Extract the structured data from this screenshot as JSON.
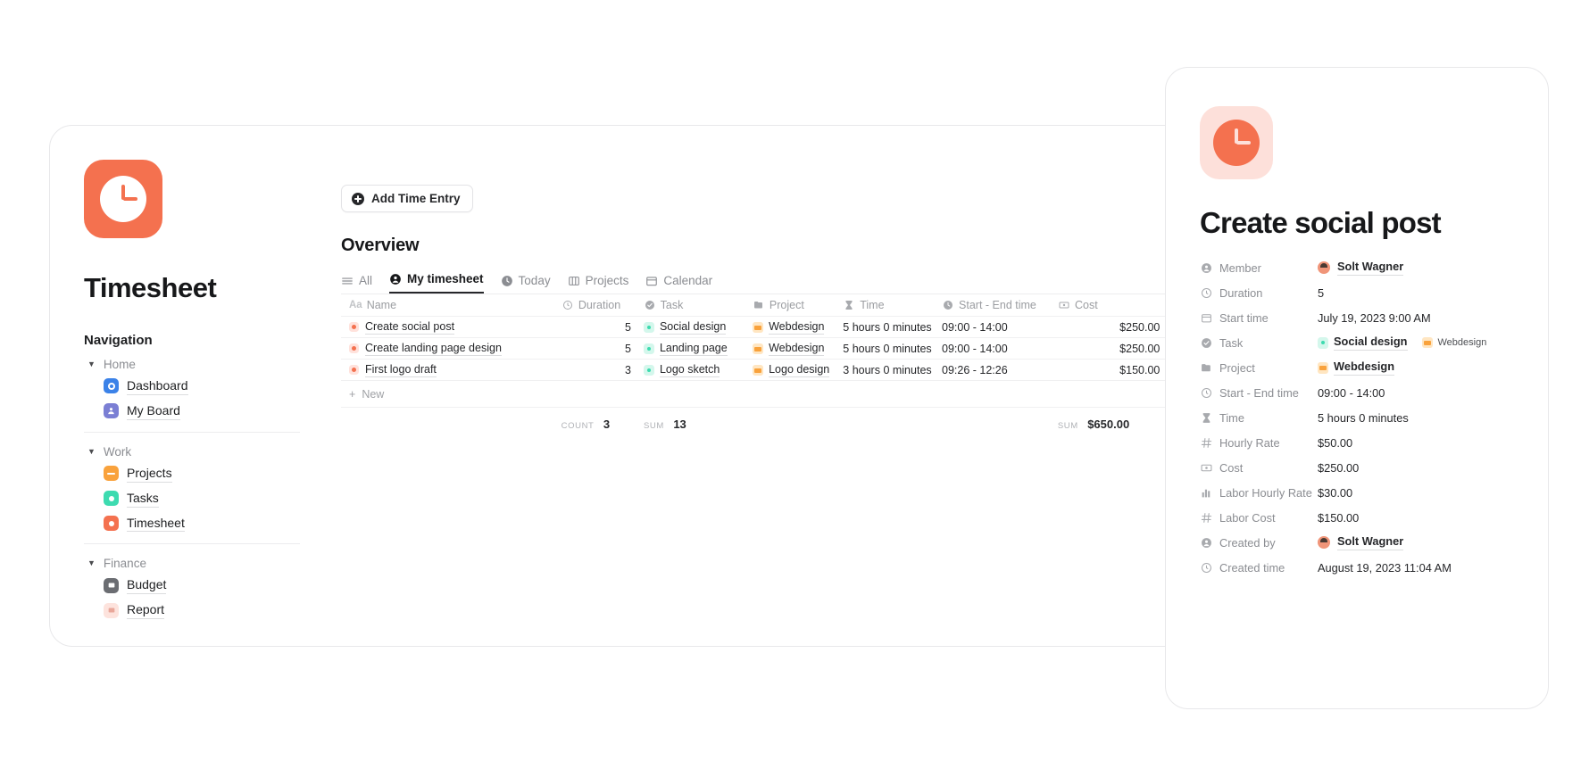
{
  "colors": {
    "brand_orange": "#f4714f",
    "brand_orange_light": "#fde0da",
    "teal": "#3ddbb0",
    "teal_light": "#d4f7ec",
    "amber": "#f9a23c",
    "amber_light": "#ffe6c2",
    "blue": "#3b82e8",
    "purple": "#7b7fd4",
    "gray_dark": "#6b6d72",
    "card_border": "#e8e8ea"
  },
  "app": {
    "icon": "clock-app-icon",
    "title": "Timesheet"
  },
  "sidebar": {
    "heading": "Navigation",
    "groups": [
      {
        "name": "Home",
        "caret": "▼",
        "items": [
          {
            "label": "Dashboard",
            "icon": "dashboard-icon",
            "color": "#3b82e8"
          },
          {
            "label": "My Board",
            "icon": "person-board-icon",
            "color": "#7b7fd4"
          }
        ]
      },
      {
        "name": "Work",
        "caret": "▼",
        "items": [
          {
            "label": "Projects",
            "icon": "folder-icon",
            "color": "#f9a23c"
          },
          {
            "label": "Tasks",
            "icon": "task-circle-icon",
            "color": "#3ddbb0"
          },
          {
            "label": "Timesheet",
            "icon": "clock-icon",
            "color": "#f4714f"
          }
        ]
      },
      {
        "name": "Finance",
        "caret": "▼",
        "items": [
          {
            "label": "Budget",
            "icon": "budget-icon",
            "color": "#6b6d72"
          },
          {
            "label": "Report",
            "icon": "report-icon",
            "color": "#e9a79a"
          }
        ]
      }
    ]
  },
  "toolbar": {
    "add_entry_label": "Add Time Entry",
    "add_icon": "plus-circle-icon"
  },
  "main": {
    "section_title": "Overview",
    "tabs": [
      {
        "label": "All",
        "icon": "list-icon",
        "active": false
      },
      {
        "label": "My timesheet",
        "icon": "person-icon",
        "active": true
      },
      {
        "label": "Today",
        "icon": "clock-icon",
        "active": false
      },
      {
        "label": "Projects",
        "icon": "columns-icon",
        "active": false
      },
      {
        "label": "Calendar",
        "icon": "calendar-icon",
        "active": false
      }
    ],
    "table": {
      "columns": [
        {
          "label": "Name",
          "icon": "aa-icon"
        },
        {
          "label": "Duration",
          "icon": "clock-icon"
        },
        {
          "label": "Task",
          "icon": "check-circle-icon"
        },
        {
          "label": "Project",
          "icon": "folder-icon"
        },
        {
          "label": "Time",
          "icon": "timer-icon"
        },
        {
          "label": "Start - End time",
          "icon": "clock-icon"
        },
        {
          "label": "Cost",
          "icon": "money-icon"
        }
      ],
      "add_column_icon": "plus-icon",
      "rows": [
        {
          "name": "Create social post",
          "duration": "5",
          "task": "Social design",
          "project": "Webdesign",
          "time": "5 hours 0 minutes",
          "start_end": "09:00 - 14:00",
          "cost": "$250.00"
        },
        {
          "name": "Create landing page design",
          "duration": "5",
          "task": "Landing page",
          "project": "Webdesign",
          "time": "5 hours 0 minutes",
          "start_end": "09:00 - 14:00",
          "cost": "$250.00"
        },
        {
          "name": "First logo draft",
          "duration": "3",
          "task": "Logo sketch",
          "project": "Logo design",
          "time": "3 hours 0 minutes",
          "start_end": "09:26 - 12:26",
          "cost": "$150.00"
        }
      ],
      "new_row_label": "New",
      "new_row_icon": "plus-icon",
      "summary": {
        "count_label": "COUNT",
        "count_value": "3",
        "duration_sum_label": "SUM",
        "duration_sum_value": "13",
        "cost_sum_label": "SUM",
        "cost_sum_value": "$650.00"
      }
    }
  },
  "detail": {
    "icon": "clock-record-icon",
    "title": "Create social post",
    "properties": [
      {
        "key": "Member",
        "icon": "person-circle-icon",
        "value": "Solt Wagner",
        "kind": "person"
      },
      {
        "key": "Duration",
        "icon": "clock-icon",
        "value": "5",
        "kind": "text"
      },
      {
        "key": "Start time",
        "icon": "calendar-icon",
        "value": "July 19, 2023 9:00 AM",
        "kind": "text"
      },
      {
        "key": "Task",
        "icon": "check-circle-icon",
        "value": "Social design",
        "kind": "task",
        "value2": "Webdesign"
      },
      {
        "key": "Project",
        "icon": "folder-icon",
        "value": "Webdesign",
        "kind": "project"
      },
      {
        "key": "Start - End time",
        "icon": "clock-icon",
        "value": "09:00 - 14:00",
        "kind": "text"
      },
      {
        "key": "Time",
        "icon": "timer-icon",
        "value": "5 hours 0 minutes",
        "kind": "text"
      },
      {
        "key": "Hourly Rate",
        "icon": "hash-icon",
        "value": "$50.00",
        "kind": "text"
      },
      {
        "key": "Cost",
        "icon": "money-icon",
        "value": "$250.00",
        "kind": "text"
      },
      {
        "key": "Labor Hourly Rate",
        "icon": "chart-icon",
        "value": "$30.00",
        "kind": "text"
      },
      {
        "key": "Labor Cost",
        "icon": "hash-icon",
        "value": "$150.00",
        "kind": "text"
      },
      {
        "key": "Created by",
        "icon": "person-circle-icon",
        "value": "Solt Wagner",
        "kind": "person"
      },
      {
        "key": "Created time",
        "icon": "clock-icon",
        "value": "August 19, 2023 11:04 AM",
        "kind": "text"
      }
    ]
  }
}
